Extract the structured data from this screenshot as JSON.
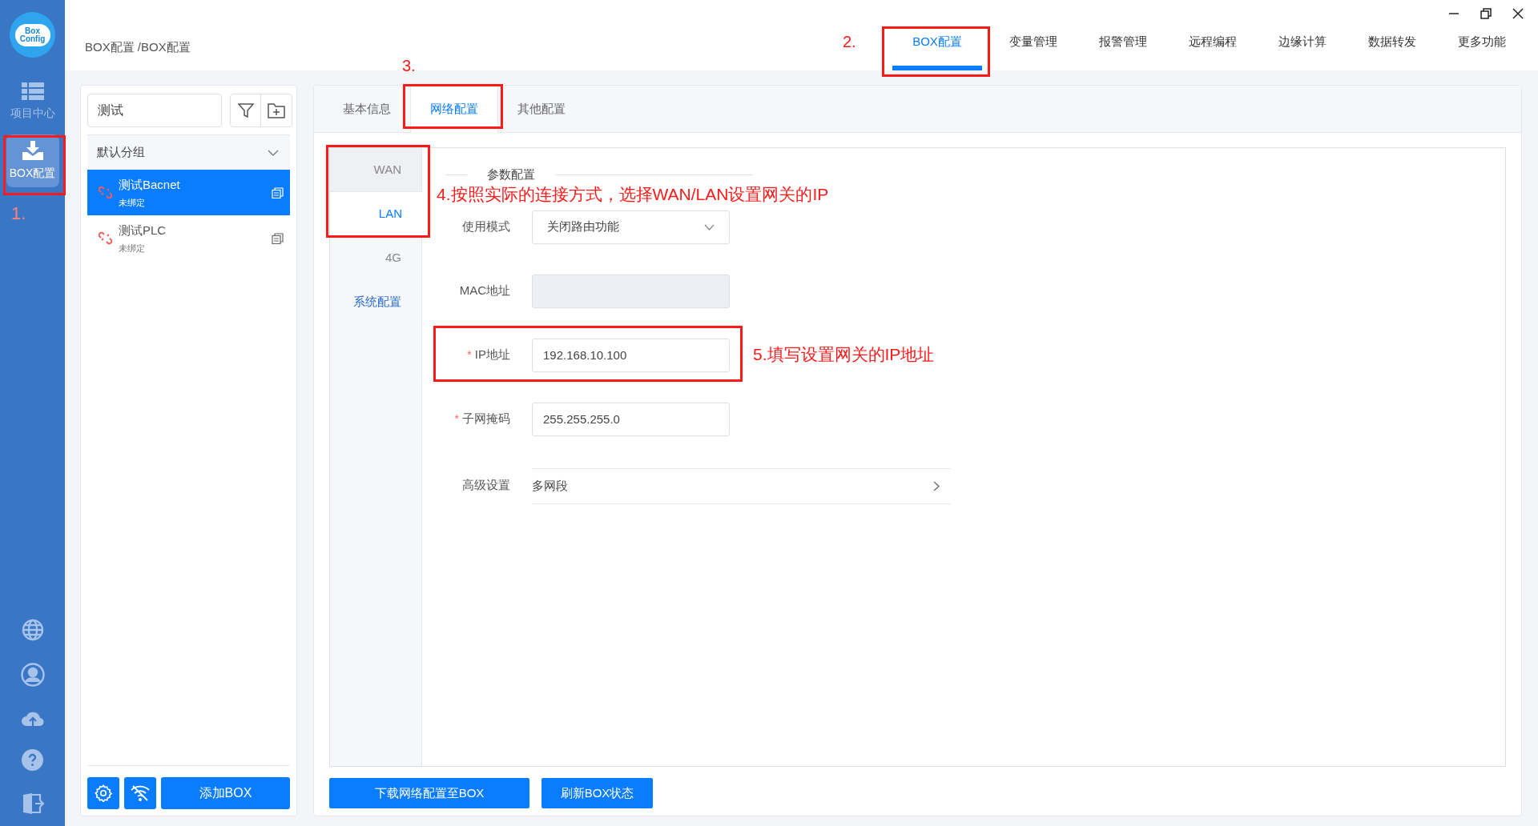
{
  "logo": {
    "lines": [
      "Box",
      "Config"
    ]
  },
  "rail": {
    "items": [
      {
        "label": "项目中心",
        "selected": false
      },
      {
        "label": "BOX配置",
        "selected": true
      }
    ]
  },
  "breadcrumb": "BOX配置 /BOX配置",
  "top_nav": [
    {
      "label": "BOX配置",
      "selected": true
    },
    {
      "label": "变量管理",
      "selected": false
    },
    {
      "label": "报警管理",
      "selected": false
    },
    {
      "label": "远程编程",
      "selected": false
    },
    {
      "label": "边缘计算",
      "selected": false
    },
    {
      "label": "数据转发",
      "selected": false
    },
    {
      "label": "更多功能",
      "selected": false
    }
  ],
  "device_panel": {
    "search": {
      "value": "测试"
    },
    "group": {
      "label": "默认分组",
      "expanded": true
    },
    "devices": [
      {
        "name": "测试Bacnet",
        "status": "未绑定",
        "selected": true
      },
      {
        "name": "测试PLC",
        "status": "未绑定",
        "selected": false
      }
    ],
    "add_button": "添加BOX"
  },
  "tabs": [
    {
      "label": "基本信息",
      "selected": false
    },
    {
      "label": "网络配置",
      "selected": true
    },
    {
      "label": "其他配置",
      "selected": false
    }
  ],
  "side_menu": [
    {
      "label": "WAN",
      "selected": false,
      "kind": "tab"
    },
    {
      "label": "LAN",
      "selected": true,
      "kind": "tab"
    },
    {
      "label": "4G",
      "selected": false,
      "kind": "tab"
    },
    {
      "label": "系统配置",
      "selected": false,
      "kind": "link"
    }
  ],
  "section_title": "参数配置",
  "form": [
    {
      "label": "使用模式",
      "kind": "select",
      "value": "关闭路由功能"
    },
    {
      "label": "MAC地址",
      "kind": "input",
      "disabled": true
    },
    {
      "label": "IP地址",
      "kind": "input",
      "value": "192.168.10.100",
      "marker": "*"
    },
    {
      "label": "子网掩码",
      "kind": "input",
      "value": "255.255.255.0",
      "marker": "*"
    },
    {
      "label": "高级设置",
      "kind": "link",
      "value": "多网段"
    }
  ],
  "actions": [
    "下载网络配置至BOX",
    "刷新BOX状态"
  ],
  "annotations": [
    "1.",
    "2.",
    "3.",
    "4.按照实际的连接方式，选择WAN/LAN设置网关的IP",
    "5.填写设置网关的IP地址"
  ]
}
